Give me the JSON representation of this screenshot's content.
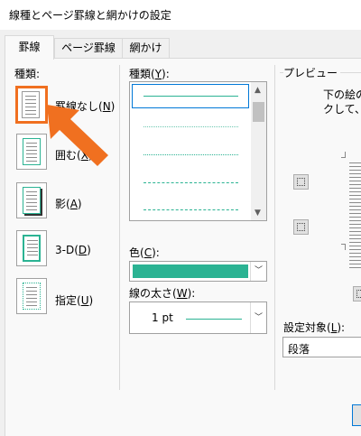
{
  "window": {
    "title": "線種とページ罫線と網かけの設定"
  },
  "tabs": [
    {
      "label": "罫線"
    },
    {
      "label": "ページ罫線"
    },
    {
      "label": "網かけ"
    }
  ],
  "settings": {
    "title": "種類:",
    "items": [
      {
        "label": "罫線なし(N)",
        "text": "罫線なし(",
        "key": "N",
        "selected": true
      },
      {
        "label": "囲む(X)",
        "text": "囲む(",
        "key": "X"
      },
      {
        "label": "影(A)",
        "text": "影(",
        "key": "A"
      },
      {
        "label": "3-D(D)",
        "text": "3-D(",
        "key": "D"
      },
      {
        "label": "指定(U)",
        "text": "指定(",
        "key": "U"
      }
    ]
  },
  "style": {
    "label_text": "種類(",
    "label_key": "Y",
    "label_end": "):",
    "line_styles": [
      "solid",
      "dotted-fine",
      "dotted",
      "dashed",
      "dash-dot"
    ]
  },
  "color": {
    "label_text": "色(",
    "label_key": "C",
    "label_end": "):",
    "value": "#2bb393"
  },
  "width": {
    "label_text": "線の太さ(",
    "label_key": "W",
    "label_end": "):",
    "value": "1 pt"
  },
  "preview": {
    "title": "プレビュー",
    "instruction_line1": "下の絵の",
    "instruction_line2": "クして、"
  },
  "apply_to": {
    "label_text": "設定対象(",
    "label_key": "L",
    "label_end": "):",
    "value": "段落"
  },
  "annotation": {
    "color": "#f07020"
  }
}
